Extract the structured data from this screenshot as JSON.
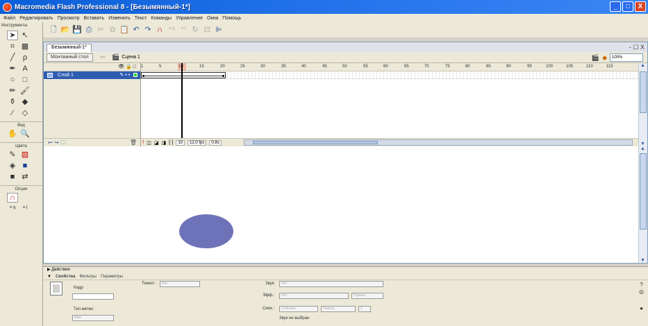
{
  "window": {
    "title": "Macromedia Flash Professional 8 - [Безымянный-1*]",
    "controls": [
      "_",
      "□",
      "X"
    ]
  },
  "menu": [
    "Файл",
    "Редактировать",
    "Просмотр",
    "Вставить",
    "Изменить",
    "Текст",
    "Команды",
    "Управление",
    "Окна",
    "Помощь"
  ],
  "tools": {
    "label": "Инструменты",
    "view_label": "Вид",
    "colors_label": "Цвета",
    "options_label": "Опции"
  },
  "document": {
    "tab": "Безымянный-1*",
    "stage_button": "Монтажный стол",
    "scene": "Сцена 1",
    "zoom": "100%",
    "doc_controls": "- ☐ X"
  },
  "timeline": {
    "ruler": [
      "1",
      "5",
      "10",
      "15",
      "20",
      "25",
      "30",
      "35",
      "40",
      "45",
      "50",
      "55",
      "60",
      "65",
      "70",
      "75",
      "80",
      "85",
      "90",
      "95",
      "100",
      "105",
      "110",
      "115"
    ],
    "layer_name": "Слой 1",
    "current_frame": "10",
    "fps": "12.0 fps",
    "time": "0.8s"
  },
  "panels": {
    "actions": "Действия",
    "tabs": [
      "Свойства",
      "Фильтры",
      "Параметры"
    ]
  },
  "properties": {
    "frame_label": "Кадр",
    "tween_label": "Tween:",
    "tween_value": "Нет",
    "label_type_label": "Тип метки:",
    "label_type_value": "Имя",
    "sound_label": "Звук:",
    "sound_value": "Нет",
    "effect_label": "Эфф.:",
    "effect_value": "Нет",
    "edit_button": "Правка...",
    "sync_label": "Синх.:",
    "sync_value": "Событие",
    "repeat_value": "Повтор",
    "repeat_count": "1",
    "no_sound": "Звук не выбран"
  },
  "colors": {
    "oval_fill": "#6e72b8",
    "layer_selected": "#2e5cb0",
    "titlebar": "#0b5fd8"
  }
}
